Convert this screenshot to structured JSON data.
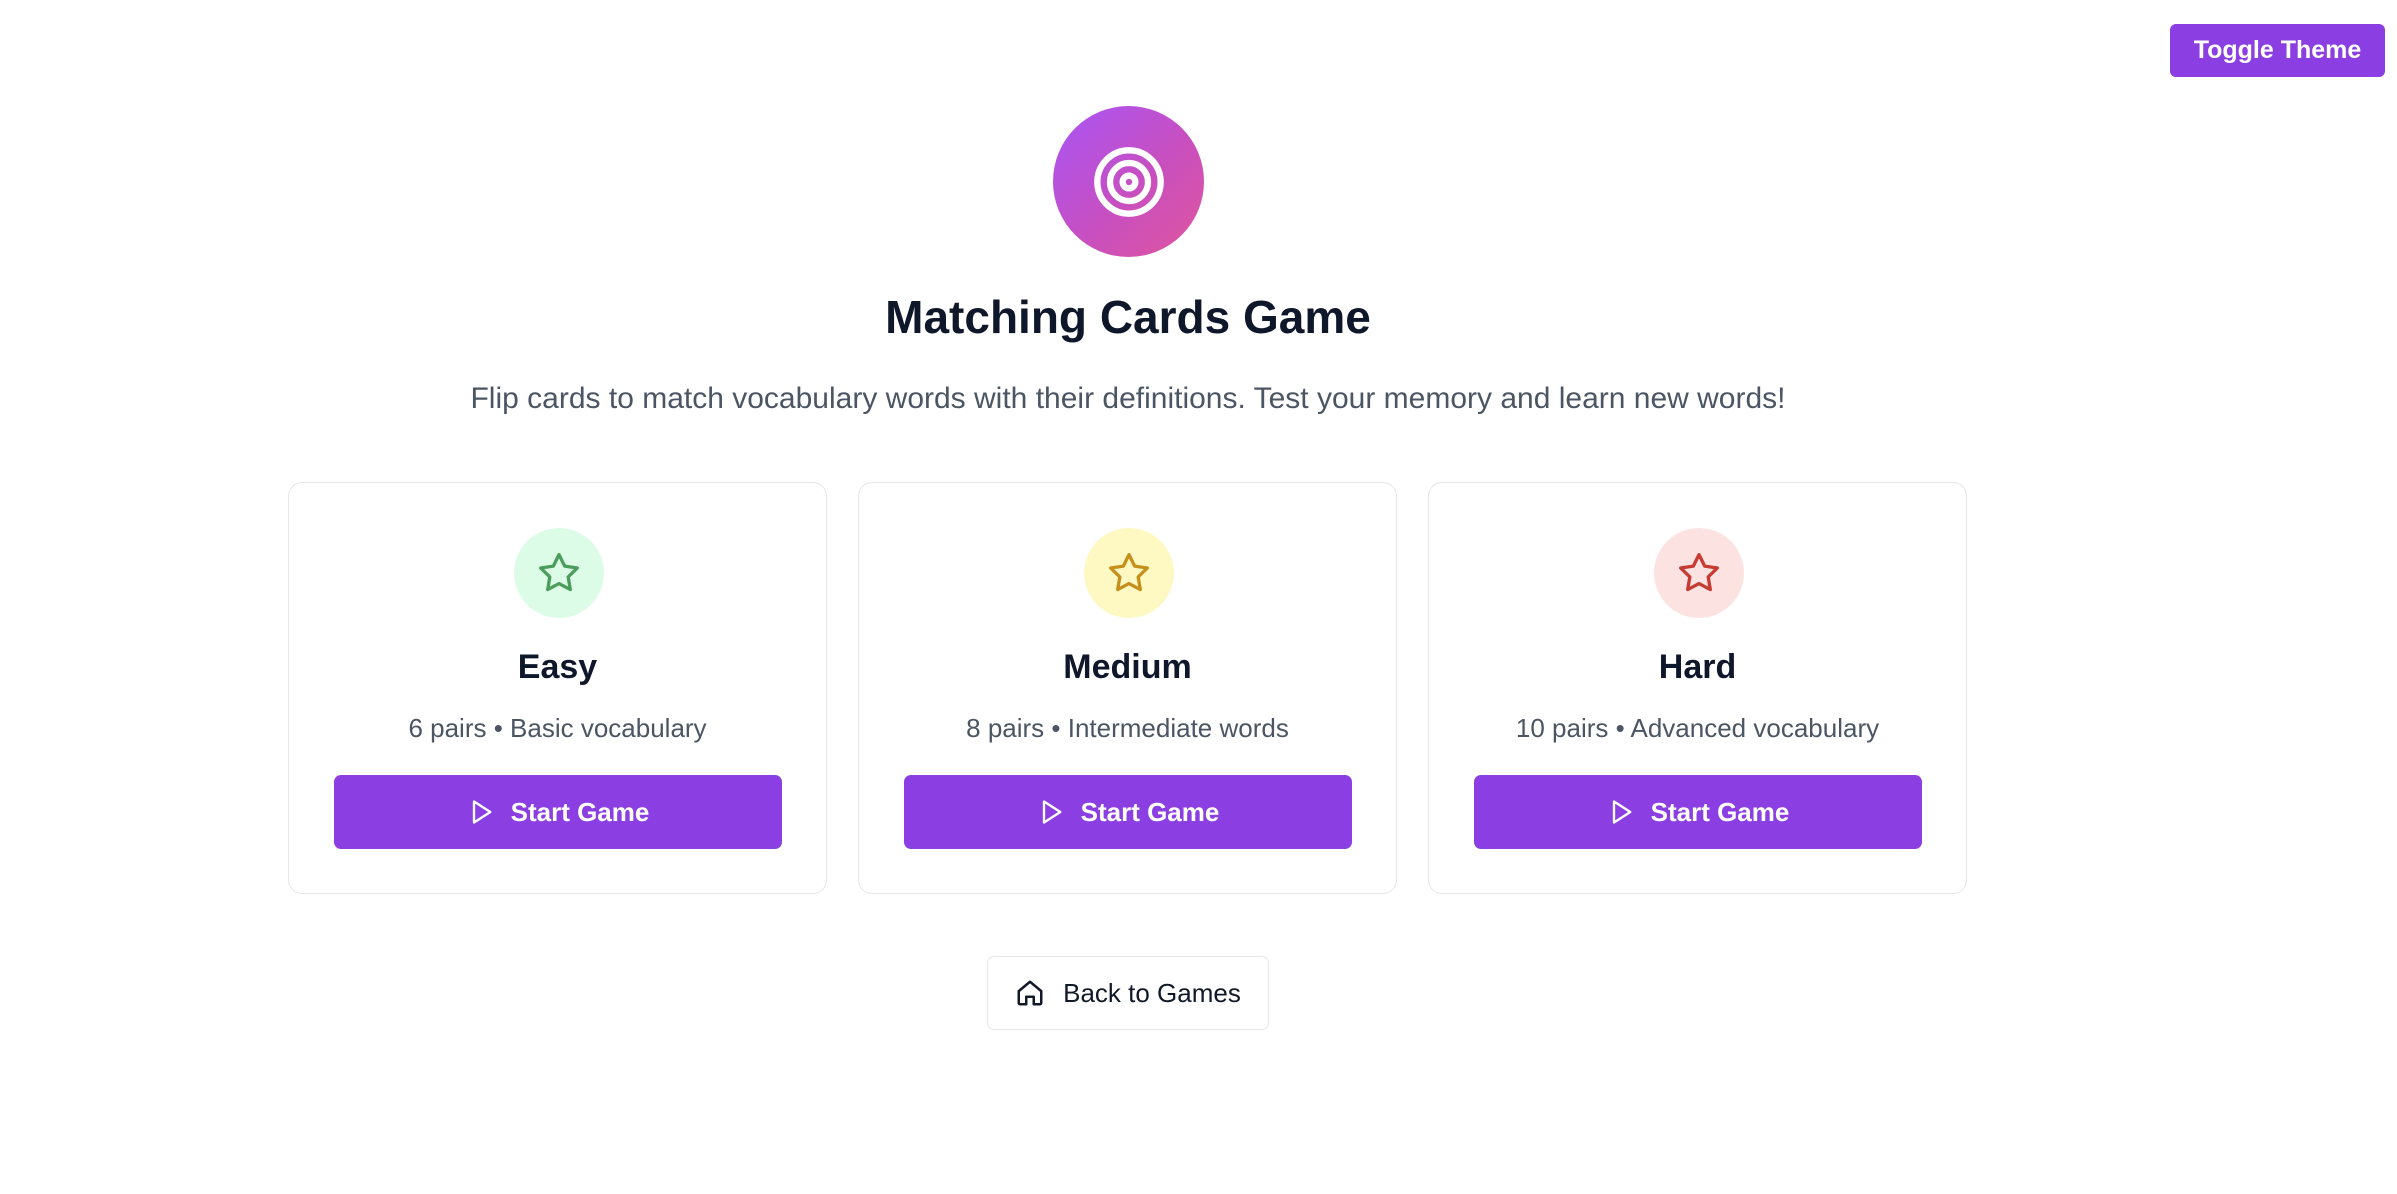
{
  "header": {
    "toggle_theme_label": "Toggle Theme"
  },
  "hero": {
    "icon": "target-icon",
    "title": "Matching Cards Game",
    "subtitle": "Flip cards to match vocabulary words with their definitions. Test your memory and learn new words!"
  },
  "difficulties": [
    {
      "name": "Easy",
      "description": "6 pairs • Basic vocabulary",
      "icon": "star-icon",
      "icon_color": "#4a9d5b",
      "icon_bg": "#dcfce7",
      "button_label": "Start Game",
      "button_icon": "play-icon"
    },
    {
      "name": "Medium",
      "description": "8 pairs • Intermediate words",
      "icon": "star-icon",
      "icon_color": "#c4901b",
      "icon_bg": "#fef9c3",
      "button_label": "Start Game",
      "button_icon": "play-icon"
    },
    {
      "name": "Hard",
      "description": "10 pairs • Advanced vocabulary",
      "icon": "star-icon",
      "icon_color": "#c63b32",
      "icon_bg": "#fde2e2",
      "button_label": "Start Game",
      "button_icon": "play-icon"
    }
  ],
  "footer": {
    "back_label": "Back to Games",
    "back_icon": "home-icon"
  },
  "colors": {
    "accent": "#8b3fe3",
    "title_text": "#0f172a",
    "muted_text": "#4b5563"
  }
}
